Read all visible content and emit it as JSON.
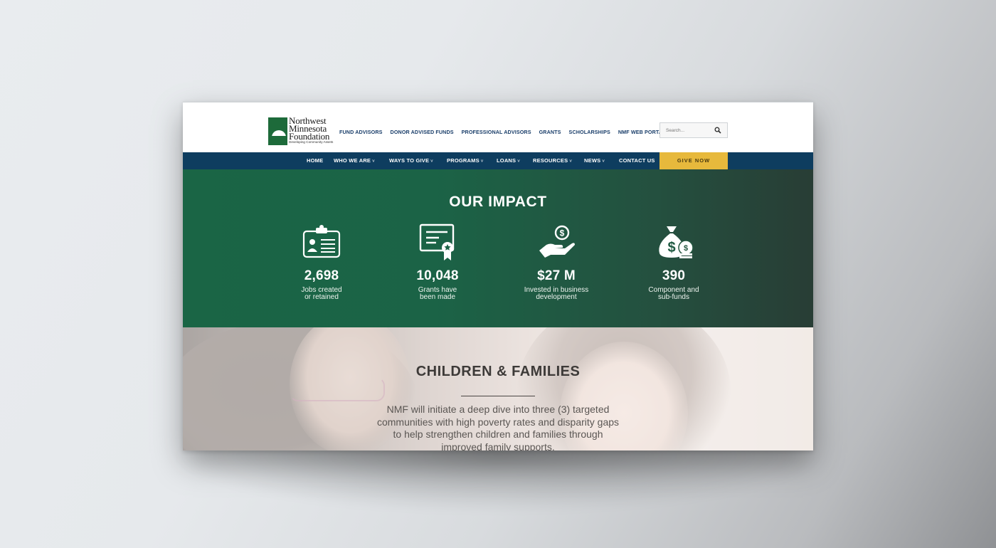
{
  "logo": {
    "lines": [
      "Northwest",
      "Minnesota",
      "Foundation"
    ],
    "tagline": "Developing Community Assets"
  },
  "top_nav": [
    "FUND ADVISORS",
    "DONOR ADVISED FUNDS",
    "PROFESSIONAL ADVISORS",
    "GRANTS",
    "SCHOLARSHIPS",
    "NMF WEB PORTAL"
  ],
  "search": {
    "placeholder": "Search..."
  },
  "main_nav": [
    {
      "label": "HOME",
      "caret": ""
    },
    {
      "label": "WHO WE ARE",
      "caret": "˅"
    },
    {
      "label": "WAYS TO GIVE",
      "caret": "˅"
    },
    {
      "label": "PROGRAMS",
      "caret": "˅"
    },
    {
      "label": "LOANS",
      "caret": "˅"
    },
    {
      "label": "RESOURCES",
      "caret": "˅"
    },
    {
      "label": "NEWS",
      "caret": "˅"
    },
    {
      "label": "CONTACT US",
      "caret": ""
    }
  ],
  "give_button": "GIVE NOW",
  "impact": {
    "title": "OUR IMPACT",
    "stats": [
      {
        "icon": "id-badge-icon",
        "value": "2,698",
        "label_lines": [
          "Jobs created",
          "or retained"
        ]
      },
      {
        "icon": "certificate-icon",
        "value": "10,048",
        "label_lines": [
          "Grants have",
          "been made"
        ]
      },
      {
        "icon": "hand-coin-icon",
        "value": "$27 M",
        "label_lines": [
          "Invested in business",
          "development"
        ]
      },
      {
        "icon": "money-bag-icon",
        "value": "390",
        "label_lines": [
          "Component and",
          "sub-funds"
        ]
      }
    ]
  },
  "children_families": {
    "title": "CHILDREN & FAMILIES",
    "text": "NMF will initiate a deep dive into three (3) targeted communities with high poverty rates and disparity gaps to help strengthen children and families through improved family supports."
  },
  "colors": {
    "nav_bg": "#0e3d5f",
    "give_btn": "#e7b93c",
    "impact_green": "#1a6545",
    "link_blue": "#1a3e6a"
  }
}
